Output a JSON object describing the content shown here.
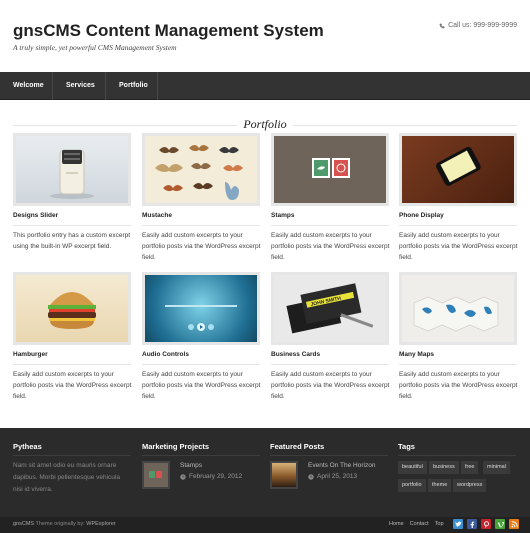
{
  "header": {
    "title": "gnsCMS Content Management System",
    "tagline": "A truly simple, yet powerful CMS Management System",
    "call_us": "Call us: 999-999-9999"
  },
  "nav": {
    "items": [
      {
        "label": "Welcome"
      },
      {
        "label": "Services"
      },
      {
        "label": "Portfolio"
      }
    ]
  },
  "section": {
    "heading": "Portfolio"
  },
  "portfolio": {
    "items": [
      {
        "title": "Designs Slider",
        "excerpt": "This portfolio entry has a custom excerpt using the built-in WP excerpt field.",
        "icon": "toaster-image"
      },
      {
        "title": "Mustache",
        "excerpt": "Easily add custom excerpts to your portfolio posts via the WordPress excerpt field.",
        "icon": "mustache-image"
      },
      {
        "title": "Stamps",
        "excerpt": "Easily add custom excerpts to your portfolio posts via the WordPress excerpt field.",
        "icon": "stamps-image"
      },
      {
        "title": "Phone Display",
        "excerpt": "Easily add custom excerpts to your portfolio posts via the WordPress excerpt field.",
        "icon": "phone-image"
      },
      {
        "title": "Hamburger",
        "excerpt": "Easily add custom excerpts to your portfolio posts via the WordPress excerpt field.",
        "icon": "hamburger-image"
      },
      {
        "title": "Audio Controls",
        "excerpt": "Easily add custom excerpts to your portfolio posts via the WordPress excerpt field.",
        "icon": "audio-controls-image"
      },
      {
        "title": "Business Cards",
        "excerpt": "Easily add custom excerpts to your portfolio posts via the WordPress excerpt field.",
        "icon": "business-cards-image",
        "card_text": "JOHN SMITH"
      },
      {
        "title": "Many Maps",
        "excerpt": "Easily add custom excerpts to your portfolio posts via the WordPress excerpt field.",
        "icon": "maps-image"
      }
    ]
  },
  "footer": {
    "about": {
      "title": "Pytheas",
      "text": "Nam sit amet odio eu mauris ornare dapibus. Morbi pellentesque vehicula nisi id viverra."
    },
    "marketing": {
      "title": "Marketing Projects",
      "post_title": "Stamps",
      "post_date": "February 29, 2012"
    },
    "featured": {
      "title": "Featured Posts",
      "post_title": "Events On The Horizon",
      "post_date": "April 25, 2013"
    },
    "tags": {
      "title": "Tags",
      "items": [
        "beautiful",
        "business",
        "free",
        "minimal",
        "portfolio",
        "theme",
        "wordpress"
      ]
    }
  },
  "bottom": {
    "copyright_prefix": "gnsCMS",
    "copyright_text": " Theme originally by: ",
    "copyright_link": "WPExplorer",
    "links": [
      "Home",
      "Contact",
      "Top"
    ],
    "socials": [
      {
        "icon": "twitter-icon",
        "color": "#3a8fd0"
      },
      {
        "icon": "facebook-icon",
        "color": "#3b5998"
      },
      {
        "icon": "pinterest-icon",
        "color": "#c8232c"
      },
      {
        "icon": "vimeo-icon",
        "color": "#4aa23b"
      },
      {
        "icon": "rss-icon",
        "color": "#e57b15"
      }
    ]
  },
  "colors": {
    "nav_bg": "#333333",
    "footer_bg": "#2b2b2b",
    "bottom_bg": "#222222"
  }
}
